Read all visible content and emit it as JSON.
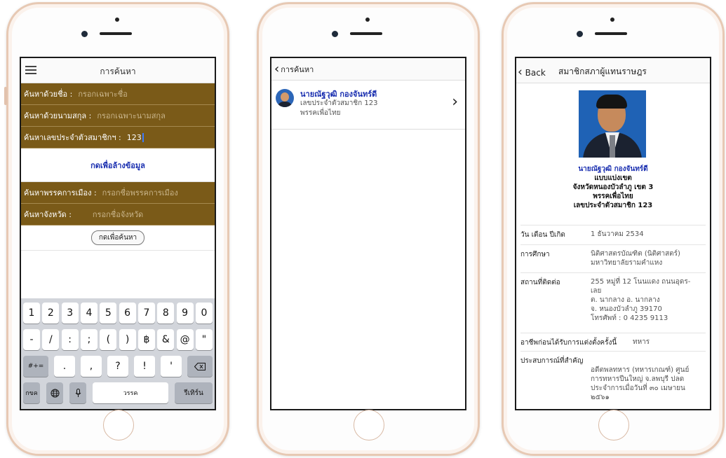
{
  "screen1": {
    "nav_title": "การค้นหา",
    "fields": [
      {
        "label": "ค้นหาด้วยชื่อ :",
        "value": "กรอกเฉพาะชื่อ",
        "filled": false
      },
      {
        "label": "ค้นหาด้วยนามสกุล :",
        "value": "กรอกเฉพาะนามสกุล",
        "filled": false
      },
      {
        "label": "ค้นหาเลขประจำตัวสมาชิกฯ :",
        "value": "123",
        "filled": true
      }
    ],
    "clear_label": "กดเพื่อล้างข้อมูล",
    "fields2": [
      {
        "label": "ค้นหาพรรคการเมือง :",
        "value": "กรอกชื่อพรรคการเมือง"
      },
      {
        "label": "ค้นหาจังหวัด :",
        "value": "กรอกชื่อจังหวัด"
      }
    ],
    "search_label": "กดเพื่อค้นหา",
    "keyboard": {
      "row1": [
        "1",
        "2",
        "3",
        "4",
        "5",
        "6",
        "7",
        "8",
        "9",
        "0"
      ],
      "row2": [
        "-",
        "/",
        ":",
        ";",
        "(",
        ")",
        "฿",
        "&",
        "@",
        "\""
      ],
      "shift_label": "#+=",
      "row3": [
        ".",
        ",",
        "?",
        "!",
        "'"
      ],
      "lang_label": "กขค",
      "space_label": "วรรค",
      "return_label": "รีเทิร์น"
    }
  },
  "screen2": {
    "back_label": "การค้นหา",
    "result": {
      "name": "นายณัฐวุฒิ กองจันทร์ดี",
      "member_no": "เลขประจำตัวสมาชิก 123",
      "party": "พรรคเพื่อไทย"
    }
  },
  "screen3": {
    "back_label": "Back",
    "title": "สมาชิกสภาผู้แทนราษฎร",
    "name": "นายณัฐวุฒิ กองจันทร์ดี",
    "type": "แบบแบ่งเขต",
    "district": "จังหวัดหนองบัวลำภู เขต 3",
    "party": "พรรคเพื่อไทย",
    "member_no": "เลขประจำตัวสมาชิก 123",
    "details": [
      {
        "label": "วัน เดือน ปีเกิด",
        "value": [
          "1 ธันวาคม 2534"
        ]
      },
      {
        "label": "การศึกษา",
        "value": [
          "นิติศาสตรบัณฑิต (นิติศาสตร์)",
          "มหาวิทยาลัยรามคำแหง"
        ]
      },
      {
        "label": "สถานที่ติดต่อ",
        "value": [
          "255 หมู่ที่ 12 โนนแดง ถนนอุดร-",
          "เลย",
          "ต. นากลาง อ. นากลาง",
          "จ. หนองบัวลำภู 39170",
          "โทรศัพท์ : 0 4235 9113"
        ]
      },
      {
        "label": "อาชีพก่อนได้รับการแต่งตั้งครั้งนี้",
        "value": [
          "ทหาร"
        ]
      },
      {
        "label": "ประสบการณ์ที่สำคัญ",
        "value": [
          "อดีตพลทหาร (ทหารเกณฑ์) ศูนย์",
          "การทหารปืนใหญ่ จ.ลพบุรี ปลด",
          "ประจำการเมื่อวันที่ ๓๐ เมษายน",
          "๒๕๖๑"
        ]
      }
    ]
  }
}
